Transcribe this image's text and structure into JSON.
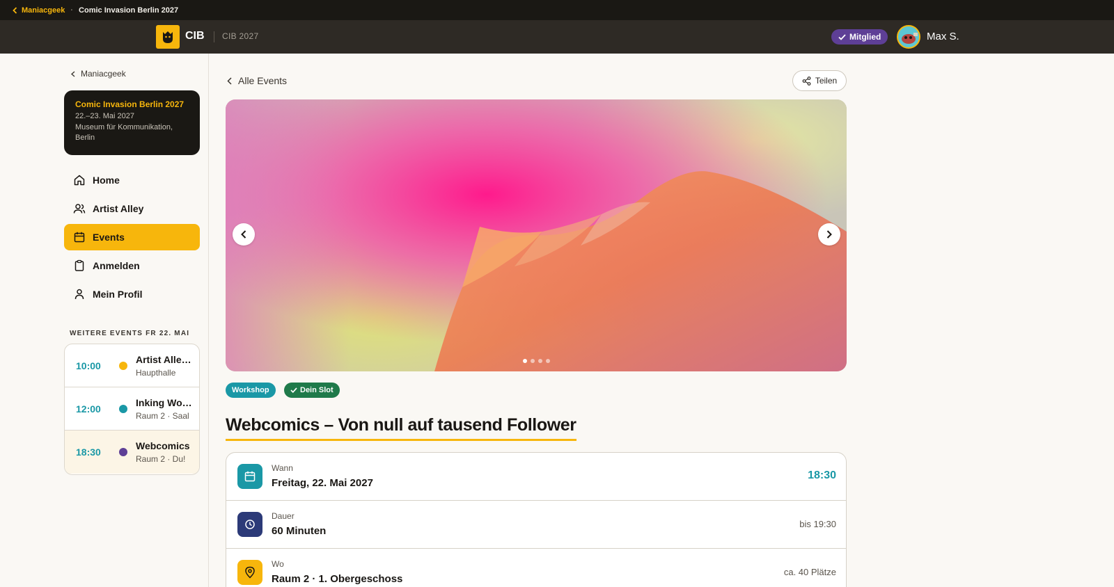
{
  "topbar": {
    "back_label": "Maniacgeek",
    "title": "Comic Invasion Berlin 2027"
  },
  "header": {
    "brand": "CIB",
    "sub_brand": "CIB 2027",
    "member_badge": "Mitglied",
    "username": "Max S."
  },
  "sidebar": {
    "back_label": "Maniacgeek",
    "event": {
      "name": "Comic Invasion Berlin 2027",
      "dates": "22.–23. Mai 2027",
      "venue_line1": "Museum für Kommunikation,",
      "venue_line2": "Berlin"
    },
    "nav": [
      {
        "label": "Home",
        "icon": "home-icon"
      },
      {
        "label": "Artist Alley",
        "icon": "users-icon"
      },
      {
        "label": "Events",
        "icon": "calendar-icon",
        "active": true
      },
      {
        "label": "Anmelden",
        "icon": "clipboard-icon"
      },
      {
        "label": "Mein Profil",
        "icon": "user-icon"
      }
    ],
    "section_label": "WEITERE EVENTS FR 22. MAI",
    "more_events": [
      {
        "time": "10:00",
        "title": "Artist Alley Opening",
        "sub": "Haupthalle",
        "dot_color": "#f7b60c"
      },
      {
        "time": "12:00",
        "title": "Inking Workshop",
        "sub": "Raum 2 · Saal",
        "dot_color": "#1a98a6"
      },
      {
        "time": "18:30",
        "title": "Webcomics",
        "sub": "Raum 2 · Du!",
        "dot_color": "#5e3f96"
      }
    ]
  },
  "main": {
    "back_label": "Alle Events",
    "share_label": "Teilen",
    "carousel": {
      "slide_count": 4,
      "active_slide": 1
    },
    "tags": {
      "type": "Workshop",
      "slot": "Dein Slot"
    },
    "title": "Webcomics – Von null auf tausend Follower",
    "details": {
      "when": {
        "label": "Wann",
        "value": "Freitag, 22. Mai 2027",
        "right": "18:30"
      },
      "duration": {
        "label": "Dauer",
        "value": "60 Minuten",
        "right": "bis 19:30"
      },
      "where": {
        "label": "Wo",
        "value": "Raum 2 · 1. Obergeschoss",
        "right": "ca. 40 Plätze"
      }
    }
  },
  "colors": {
    "accent": "#f7b60c",
    "teal": "#1a98a6",
    "purple": "#5e3f96",
    "green": "#1f7a4a",
    "navy": "#2c3a78"
  }
}
